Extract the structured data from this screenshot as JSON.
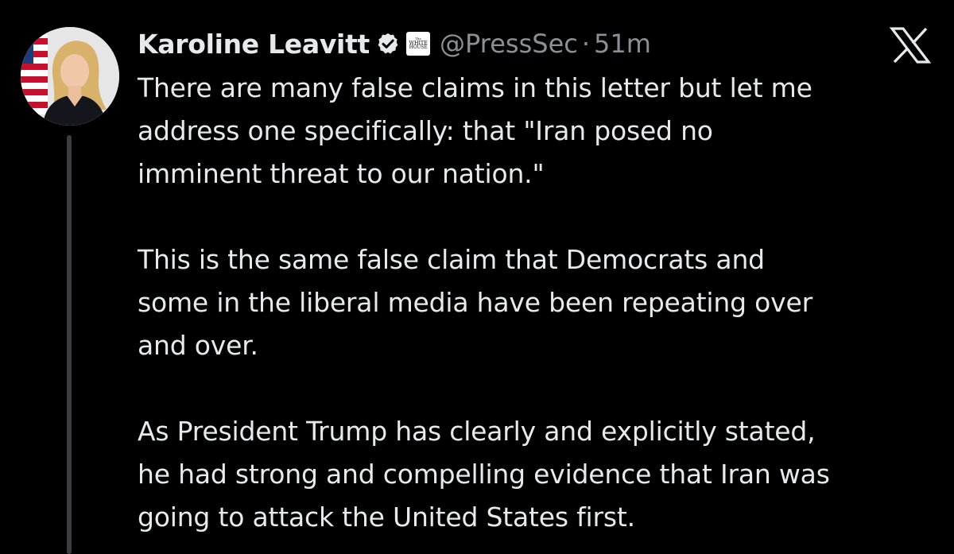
{
  "author": {
    "display_name": "Karoline Leavitt",
    "handle": "@PressSec",
    "separator": "·",
    "time_ago": "51m",
    "verified_icon": "verified-check-badge",
    "affiliation_badge": {
      "line1": "The",
      "line2": "WHITE",
      "line3": "HOUSE"
    }
  },
  "platform": {
    "logo_icon": "x-logo"
  },
  "tweet": {
    "paragraphs": [
      "There are many false claims in this letter but let me\naddress one specifically: that \"Iran posed no\nimminent threat to our nation.\"",
      "This is the same false claim that Democrats and\nsome in the liberal media have been repeating over\nand over.",
      "As President Trump has clearly and explicitly stated,\nhe had strong and compelling evidence that Iran was\ngoing to attack the United States first."
    ]
  },
  "colors": {
    "background": "#000000",
    "primary_text": "#e7e9ea",
    "secondary_text": "#8b9097",
    "thread_line": "#3a3d42",
    "verified_fill": "#e7e9ea"
  }
}
